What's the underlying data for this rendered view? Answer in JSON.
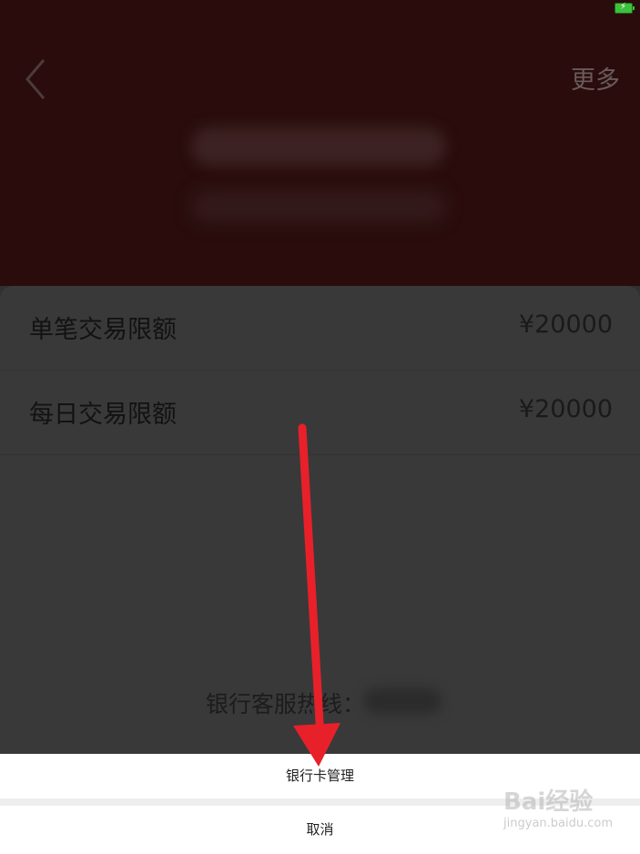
{
  "status_bar": {
    "battery_icon": "battery-charging-icon"
  },
  "header": {
    "back_icon": "chevron-left-icon",
    "more_label": "更多"
  },
  "limits": [
    {
      "label": "单笔交易限额",
      "value": "¥20000"
    },
    {
      "label": "每日交易限额",
      "value": "¥20000"
    }
  ],
  "hotline_label": "银行客服热线：",
  "action_sheet": {
    "manage_label": "银行卡管理",
    "cancel_label": "取消"
  },
  "annotation": {
    "arrow_color": "#e8202a"
  },
  "watermark": {
    "brand": "Bai经验",
    "url": "jingyan.baidu.com"
  }
}
